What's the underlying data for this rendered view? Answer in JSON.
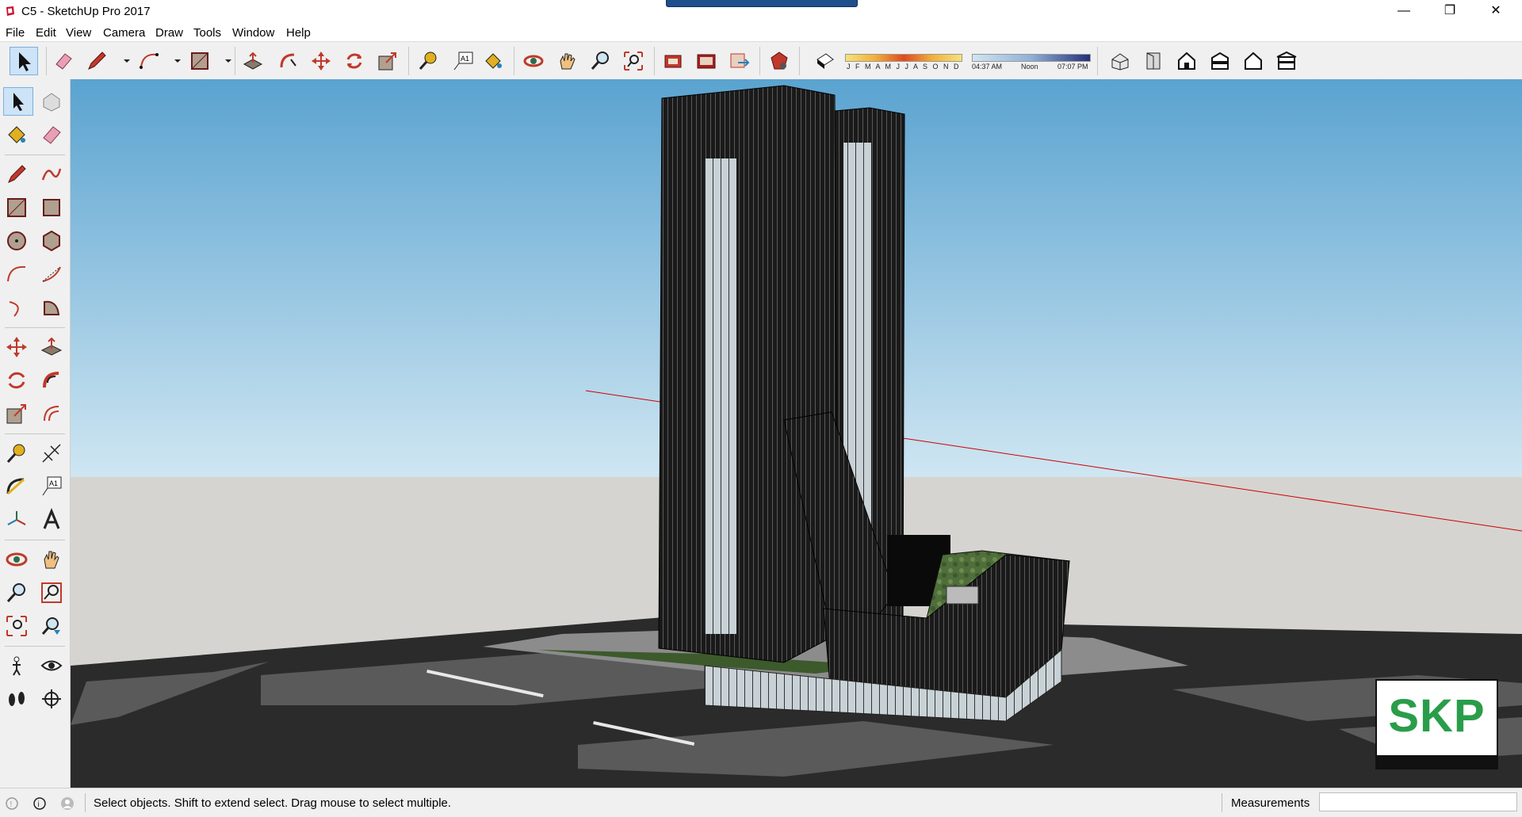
{
  "window": {
    "title": "C5 - SketchUp Pro 2017",
    "minimize_label": "—",
    "restore_label": "❐",
    "close_label": "✕"
  },
  "menu": [
    "File",
    "Edit",
    "View",
    "Camera",
    "Draw",
    "Tools",
    "Window",
    "Help"
  ],
  "shadow_settings": {
    "months": "J F M A M J J A S O N D",
    "time_start": "04:37 AM",
    "time_mid": "Noon",
    "time_end": "07:07 PM"
  },
  "status": {
    "hint": "Select objects. Shift to extend select. Drag mouse to select multiple.",
    "measurements_label": "Measurements",
    "measurements_value": ""
  },
  "watermark": {
    "text": "SKP"
  },
  "colors": {
    "sky_top": "#5aa3d0",
    "sky_bottom": "#cfe6f2",
    "ground": "#d6d4d0",
    "road": "#2b2b2b",
    "building": "#1e1e1e",
    "roof_green": "#4f6e3b",
    "axis_red": "#cc0000",
    "skp_green": "#2a9d4a"
  }
}
